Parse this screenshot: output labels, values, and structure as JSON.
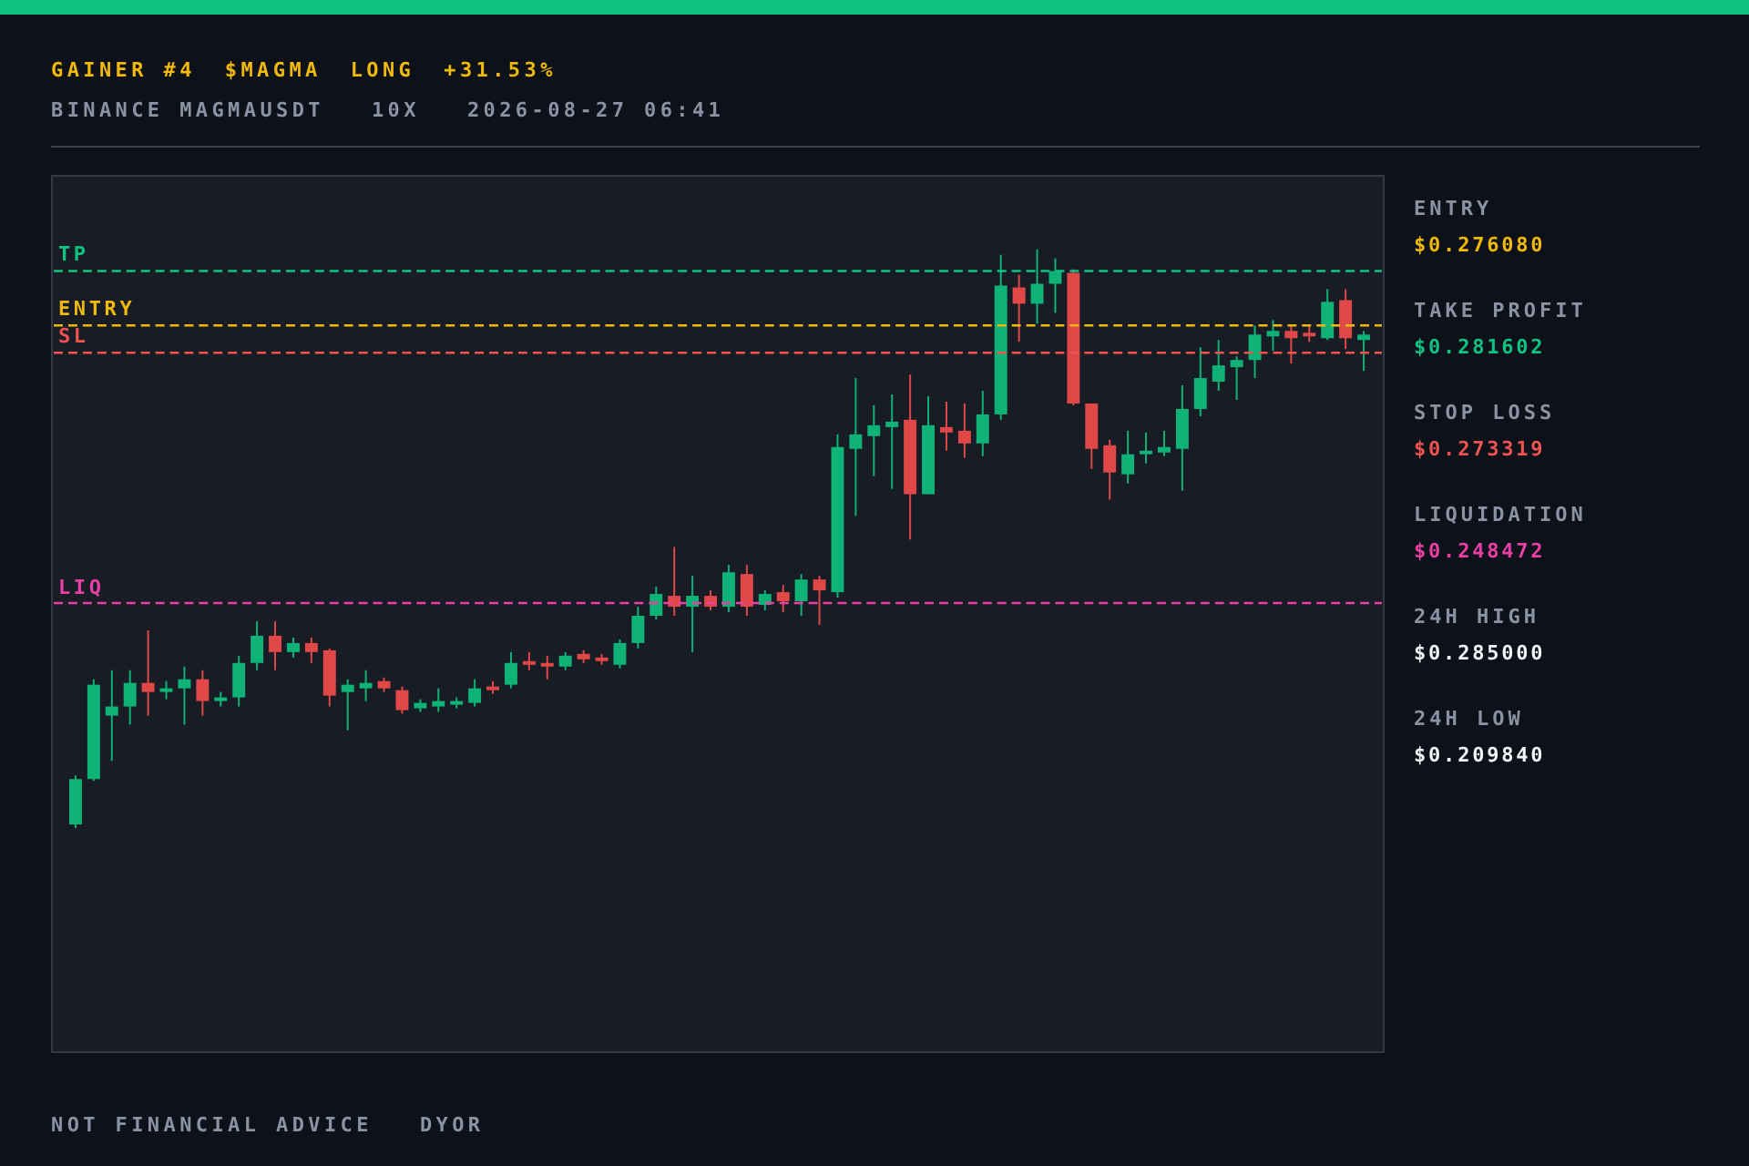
{
  "header": {
    "line_1": [
      {
        "text": "GAINER #4"
      },
      {
        "text": "$MAGMA"
      },
      {
        "text": "LONG"
      },
      {
        "text": "+31.53%"
      }
    ],
    "line_2": [
      {
        "text": "BINANCE MAGMAUSDT"
      },
      {
        "text": "10X"
      },
      {
        "text": "2026-08-27 06:41"
      }
    ]
  },
  "chart": {
    "levels": [
      {
        "label": "TP",
        "kind": "tp"
      },
      {
        "label": "ENTRY",
        "kind": "entry"
      },
      {
        "label": "SL",
        "kind": "sl"
      },
      {
        "label": "LIQ",
        "kind": "liq"
      }
    ]
  },
  "stats": [
    {
      "label": "ENTRY",
      "value": "$0.276080",
      "kind": "entry"
    },
    {
      "label": "TAKE PROFIT",
      "value": "$0.281602",
      "kind": "tp"
    },
    {
      "label": "STOP LOSS",
      "value": "$0.273319",
      "kind": "sl"
    },
    {
      "label": "LIQUIDATION",
      "value": "$0.248472",
      "kind": "liq"
    },
    {
      "label": "24H HIGH",
      "value": "$0.285000",
      "kind": "plain"
    },
    {
      "label": "24H LOW",
      "value": "$0.209840",
      "kind": "plain"
    }
  ],
  "footer": [
    {
      "text": "NOT FINANCIAL ADVICE"
    },
    {
      "text": "DYOR"
    }
  ]
}
